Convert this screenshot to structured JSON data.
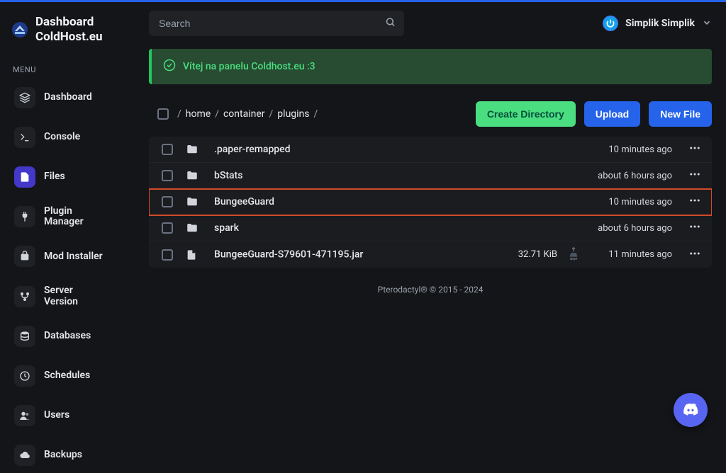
{
  "brand": {
    "line1": "Dashboard",
    "line2": "ColdHost.eu"
  },
  "menu_label": "MENU",
  "nav": [
    {
      "label": "Dashboard",
      "icon": "layers"
    },
    {
      "label": "Console",
      "icon": "terminal"
    },
    {
      "label": "Files",
      "icon": "file",
      "active": true
    },
    {
      "label": "Plugin\nManager",
      "icon": "plug"
    },
    {
      "label": "Mod Installer",
      "icon": "package"
    },
    {
      "label": "Server\nVersion",
      "icon": "branch"
    },
    {
      "label": "Databases",
      "icon": "database"
    },
    {
      "label": "Schedules",
      "icon": "clock"
    },
    {
      "label": "Users",
      "icon": "users"
    },
    {
      "label": "Backups",
      "icon": "cloud"
    }
  ],
  "search": {
    "placeholder": "Search"
  },
  "user": {
    "name": "Simplik Simplik"
  },
  "alert": {
    "text": "Vítej na panelu Coldhost.eu :3"
  },
  "breadcrumbs": [
    "home",
    "container",
    "plugins"
  ],
  "buttons": {
    "create_directory": "Create Directory",
    "upload": "Upload",
    "new_file": "New File"
  },
  "files": [
    {
      "name": ".paper-remapped",
      "type": "folder",
      "size": "",
      "modified": "10 minutes ago",
      "highlight": false
    },
    {
      "name": "bStats",
      "type": "folder",
      "size": "",
      "modified": "about 6 hours ago",
      "highlight": false
    },
    {
      "name": "BungeeGuard",
      "type": "folder",
      "size": "",
      "modified": "10 minutes ago",
      "highlight": true
    },
    {
      "name": "spark",
      "type": "folder",
      "size": "",
      "modified": "about 6 hours ago",
      "highlight": false
    },
    {
      "name": "BungeeGuard-S79601-471195.jar",
      "type": "file",
      "size": "32.71 KiB",
      "modified": "11 minutes ago",
      "highlight": false,
      "thumb": true
    }
  ],
  "footer": "Pterodactyl® © 2015 - 2024"
}
